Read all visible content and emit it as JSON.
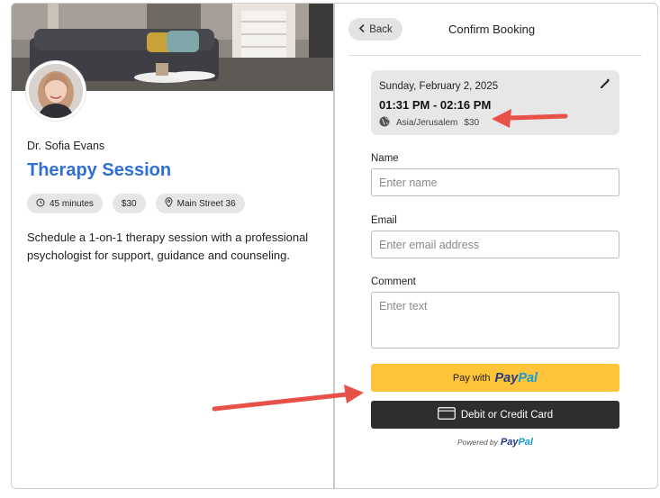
{
  "event": {
    "host_name": "Dr. Sofia Evans",
    "title": "Therapy Session",
    "duration": "45 minutes",
    "price": "$30",
    "location": "Main Street 36",
    "description": "Schedule a 1-on-1 therapy session with a professional psychologist for support, guidance and counseling."
  },
  "header": {
    "back_label": "Back",
    "title": "Confirm Booking"
  },
  "summary": {
    "date": "Sunday, February 2, 2025",
    "time": "01:31 PM - 02:16 PM",
    "timezone": "Asia/Jerusalem",
    "price": "$30"
  },
  "form": {
    "name_label": "Name",
    "name_placeholder": "Enter name",
    "email_label": "Email",
    "email_placeholder": "Enter email address",
    "comment_label": "Comment",
    "comment_placeholder": "Enter text"
  },
  "payment": {
    "paypal_prefix": "Pay with",
    "paypal_word_1": "Pay",
    "paypal_word_2": "Pal",
    "card_label": "Debit or Credit Card",
    "powered_prefix": "Powered by"
  },
  "colors": {
    "accent": "#2f6fd6",
    "paypal_yellow": "#ffc439",
    "card_dark": "#2c2e2f",
    "annotation_arrow": "#e8514a"
  }
}
